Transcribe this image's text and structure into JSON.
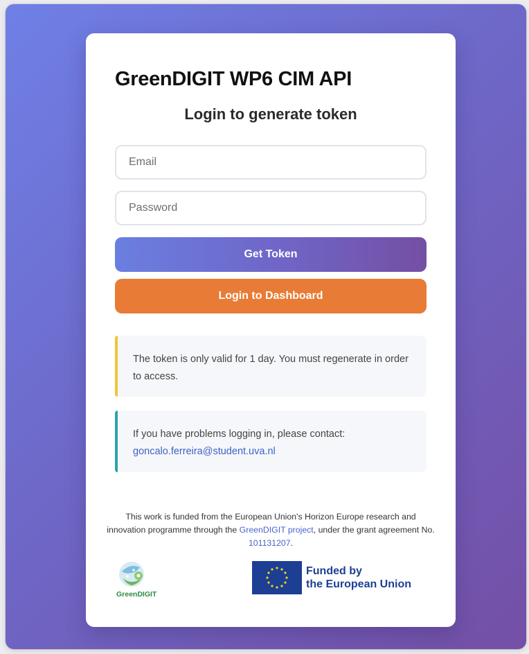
{
  "page": {
    "title": "GreenDIGIT WP6 CIM API",
    "subtitle": "Login to generate token"
  },
  "form": {
    "email_placeholder": "Email",
    "password_placeholder": "Password",
    "get_token_label": "Get Token",
    "dashboard_label": "Login to Dashboard"
  },
  "notes": {
    "warning": "The token is only valid for 1 day. You must regenerate in order to access.",
    "contact_text": "If you have problems logging in, please contact:",
    "contact_email": "goncalo.ferreira@student.uva.nl"
  },
  "footer": {
    "text_1": "This work is funded from the European Union's Horizon Europe research and innovation programme through the ",
    "project_link": "GreenDIGIT project",
    "text_2": ", under the grant agreement No. ",
    "grant_number": "101131207",
    "text_3": "."
  },
  "logos": {
    "greendigit_label": "GreenDIGIT",
    "eu_line1": "Funded by",
    "eu_line2": "the European Union"
  },
  "colors": {
    "background_gradient_start": "#6f80e6",
    "background_gradient_end": "#744fa6",
    "dashboard_button": "#e87b35",
    "warning_accent": "#f0c43a",
    "contact_accent": "#2aa3a8",
    "eu_blue": "#1c3f94"
  }
}
